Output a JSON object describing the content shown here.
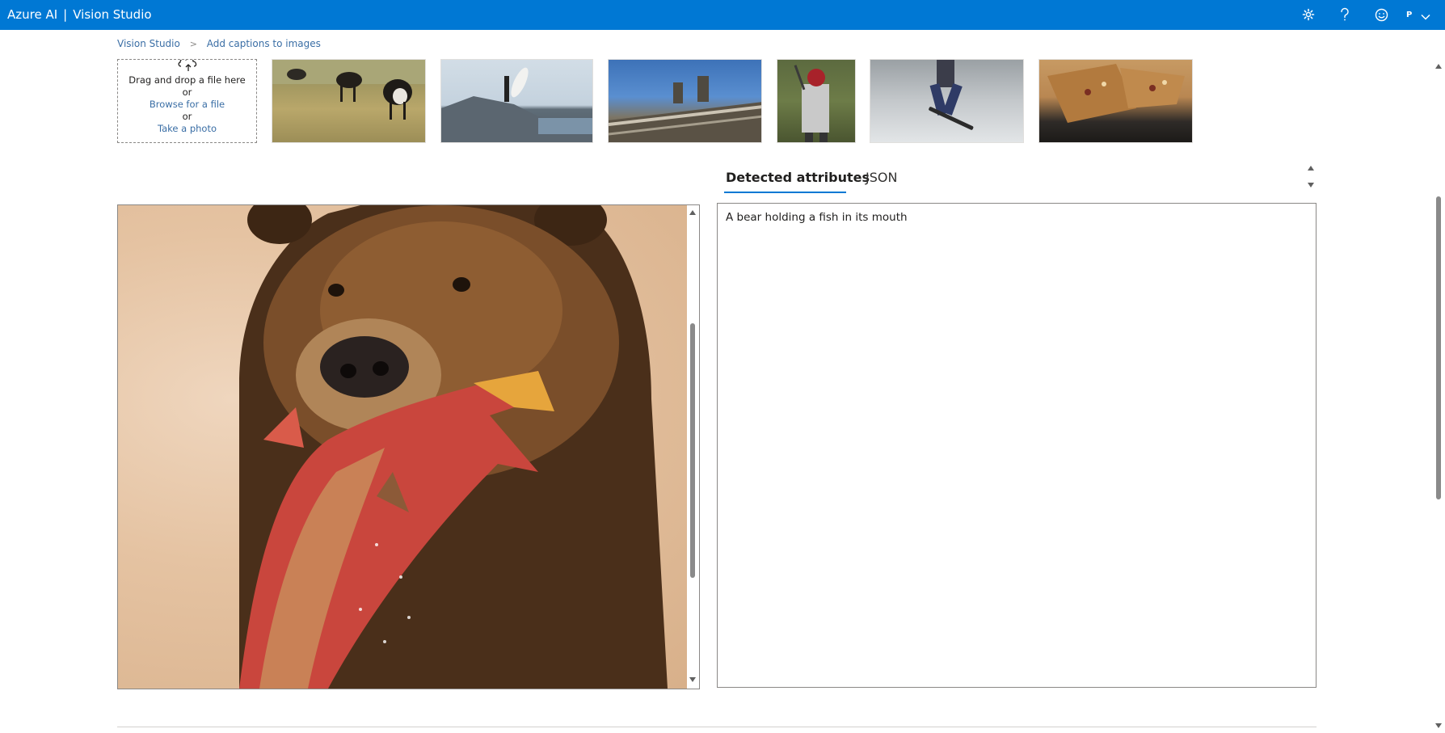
{
  "header": {
    "product": "Azure AI",
    "separator": "|",
    "app": "Vision Studio",
    "icons": [
      "gear-icon",
      "help-icon",
      "feedback-smiley-icon"
    ],
    "avatar_initial": "P",
    "colors": {
      "bar": "#0078d4",
      "text": "#ffffff"
    }
  },
  "breadcrumb": {
    "items": [
      "Vision Studio",
      "Add captions to images"
    ]
  },
  "upload": {
    "drag_text": "Drag and drop a file here",
    "or1": "or",
    "browse_link": "Browse for a file",
    "or2": "or",
    "photo_link": "Take a photo"
  },
  "samples": [
    "cows-grazing-thumbnail",
    "surfer-on-rocks-thumbnail",
    "statues-on-building-thumbnail",
    "baseball-batter-thumbnail",
    "skateboarder-thumbnail",
    "grilled-sandwich-thumbnail"
  ],
  "tabs": [
    {
      "label": "Detected attributes",
      "active": true
    },
    {
      "label": "JSON",
      "active": false
    }
  ],
  "result": {
    "caption": "A bear holding a fish in its mouth"
  },
  "accent": "#0078d4"
}
